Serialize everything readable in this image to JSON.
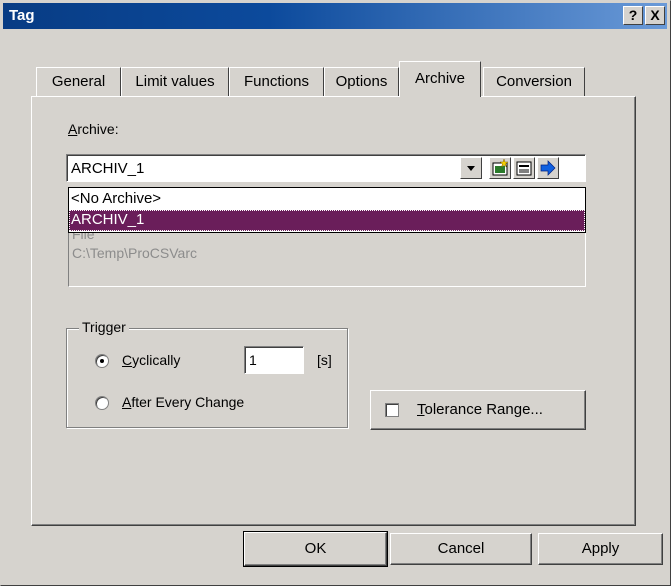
{
  "window": {
    "title": "Tag",
    "help_button": "?",
    "close_button": "X"
  },
  "tabs": [
    {
      "label": "General",
      "active": false
    },
    {
      "label": "Limit values",
      "active": false
    },
    {
      "label": "Functions",
      "active": false
    },
    {
      "label": "Options",
      "active": false
    },
    {
      "label": "Archive",
      "active": true
    },
    {
      "label": "Conversion",
      "active": false
    }
  ],
  "archive": {
    "label_prefix": "A",
    "label_rest": "rchive:",
    "selected_value": "ARCHIV_1",
    "dropdown_options": [
      "<No Archive>",
      "ARCHIV_1"
    ],
    "selected_option_index": 1,
    "detail_lines": [
      "File",
      "C:\\Temp\\ProCSVarc"
    ],
    "icons": [
      "new-archive-icon",
      "properties-icon",
      "goto-icon"
    ]
  },
  "trigger": {
    "title": "Trigger",
    "cyclically_prefix": "C",
    "cyclically_rest": "yclically",
    "cyclically_selected": true,
    "cycle_value": "1",
    "cycle_unit": "[s]",
    "after_change_prefix": "A",
    "after_change_rest": "fter Every Change",
    "after_change_selected": false
  },
  "tolerance": {
    "label_prefix": "T",
    "label_rest": "olerance Range...",
    "checked": false
  },
  "buttons": {
    "ok": "OK",
    "cancel": "Cancel",
    "apply": "Apply"
  },
  "colors": {
    "titlebar_start": "#083c84",
    "selection": "#6a1e5a",
    "face": "#d6d3ce"
  }
}
